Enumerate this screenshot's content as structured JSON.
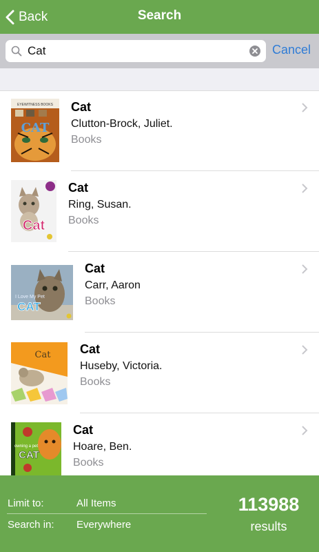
{
  "header": {
    "back_label": "Back",
    "title": "Search"
  },
  "search": {
    "query": "Cat",
    "cancel_label": "Cancel"
  },
  "results": [
    {
      "title": "Cat",
      "author": "Clutton-Brock, Juliet.",
      "type": "Books",
      "cover_text": "CAT",
      "cover_top": "EYEWITNESS BOOKS"
    },
    {
      "title": "Cat",
      "author": "Ring, Susan.",
      "type": "Books",
      "cover_text": "Cat"
    },
    {
      "title": "Cat",
      "author": "Carr, Aaron",
      "type": "Books",
      "cover_text": "CAT",
      "cover_top": "I Love My Pet"
    },
    {
      "title": "Cat",
      "author": "Huseby, Victoria.",
      "type": "Books",
      "cover_text": "Cat"
    },
    {
      "title": "Cat",
      "author": "Hoare, Ben.",
      "type": "Books",
      "cover_text": "CAT",
      "cover_top": "owning a pet"
    }
  ],
  "footer": {
    "limit_label": "Limit to:",
    "limit_value": "All Items",
    "searchin_label": "Search in:",
    "searchin_value": "Everywhere",
    "count": "113988",
    "count_label": "results"
  },
  "colors": {
    "brand_green": "#6aa84f",
    "link_blue": "#2f7cd6",
    "secondary_text": "#8e8e93"
  }
}
